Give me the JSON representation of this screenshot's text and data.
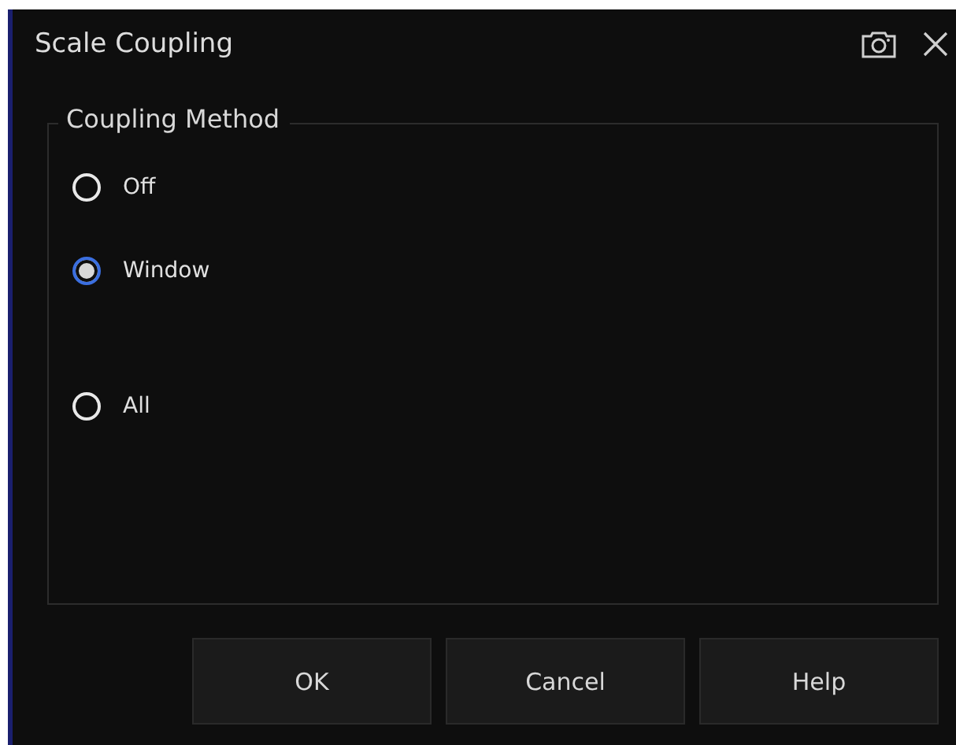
{
  "window": {
    "title": "Scale Coupling"
  },
  "group": {
    "title": "Coupling Method",
    "options": [
      {
        "label": "Off",
        "selected": false
      },
      {
        "label": "Window",
        "selected": true
      },
      {
        "label": "All",
        "selected": false
      }
    ]
  },
  "buttons": [
    "OK",
    "Cancel",
    "Help"
  ]
}
